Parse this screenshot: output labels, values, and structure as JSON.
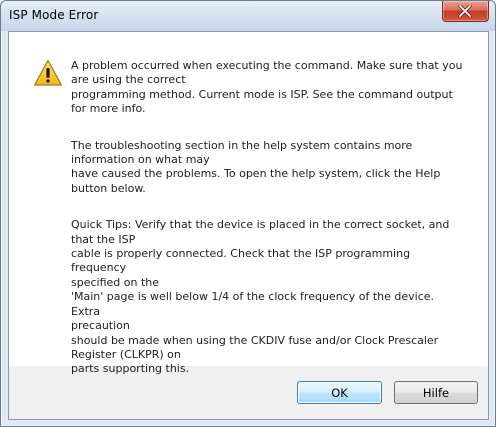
{
  "window": {
    "title": "ISP Mode Error"
  },
  "titlebar_buttons": {
    "close_icon": "close-x-icon"
  },
  "dialog": {
    "icon": "warning-triangle-icon",
    "paragraphs": [
      {
        "lines": [
          "A problem occurred when executing the command. Make sure that you",
          "are using the correct",
          "programming method. Current mode is ISP. See the command output",
          "for more info."
        ]
      },
      {
        "lines": [
          "The troubleshooting section in the help system contains more",
          "information on what may",
          "have caused the problems. To open the help system, click the Help",
          "button below."
        ]
      },
      {
        "lines": [
          "Quick Tips: Verify that the device is placed in the correct socket, and",
          "that the ISP",
          "cable is properly connected. Check that the ISP programming frequency",
          "specified on the",
          "'Main' page is well below 1/4 of the clock frequency of the device. Extra",
          "precaution",
          "should be made when using the CKDIV fuse and/or Clock Prescaler",
          "Register (CLKPR) on",
          "parts supporting this."
        ]
      }
    ]
  },
  "buttons": {
    "ok_label": "OK",
    "help_label": "Hilfe"
  },
  "colors": {
    "accent_focus": "#3c7fb1",
    "close_red": "#c23b24",
    "warning_yellow": "#f6c623"
  }
}
